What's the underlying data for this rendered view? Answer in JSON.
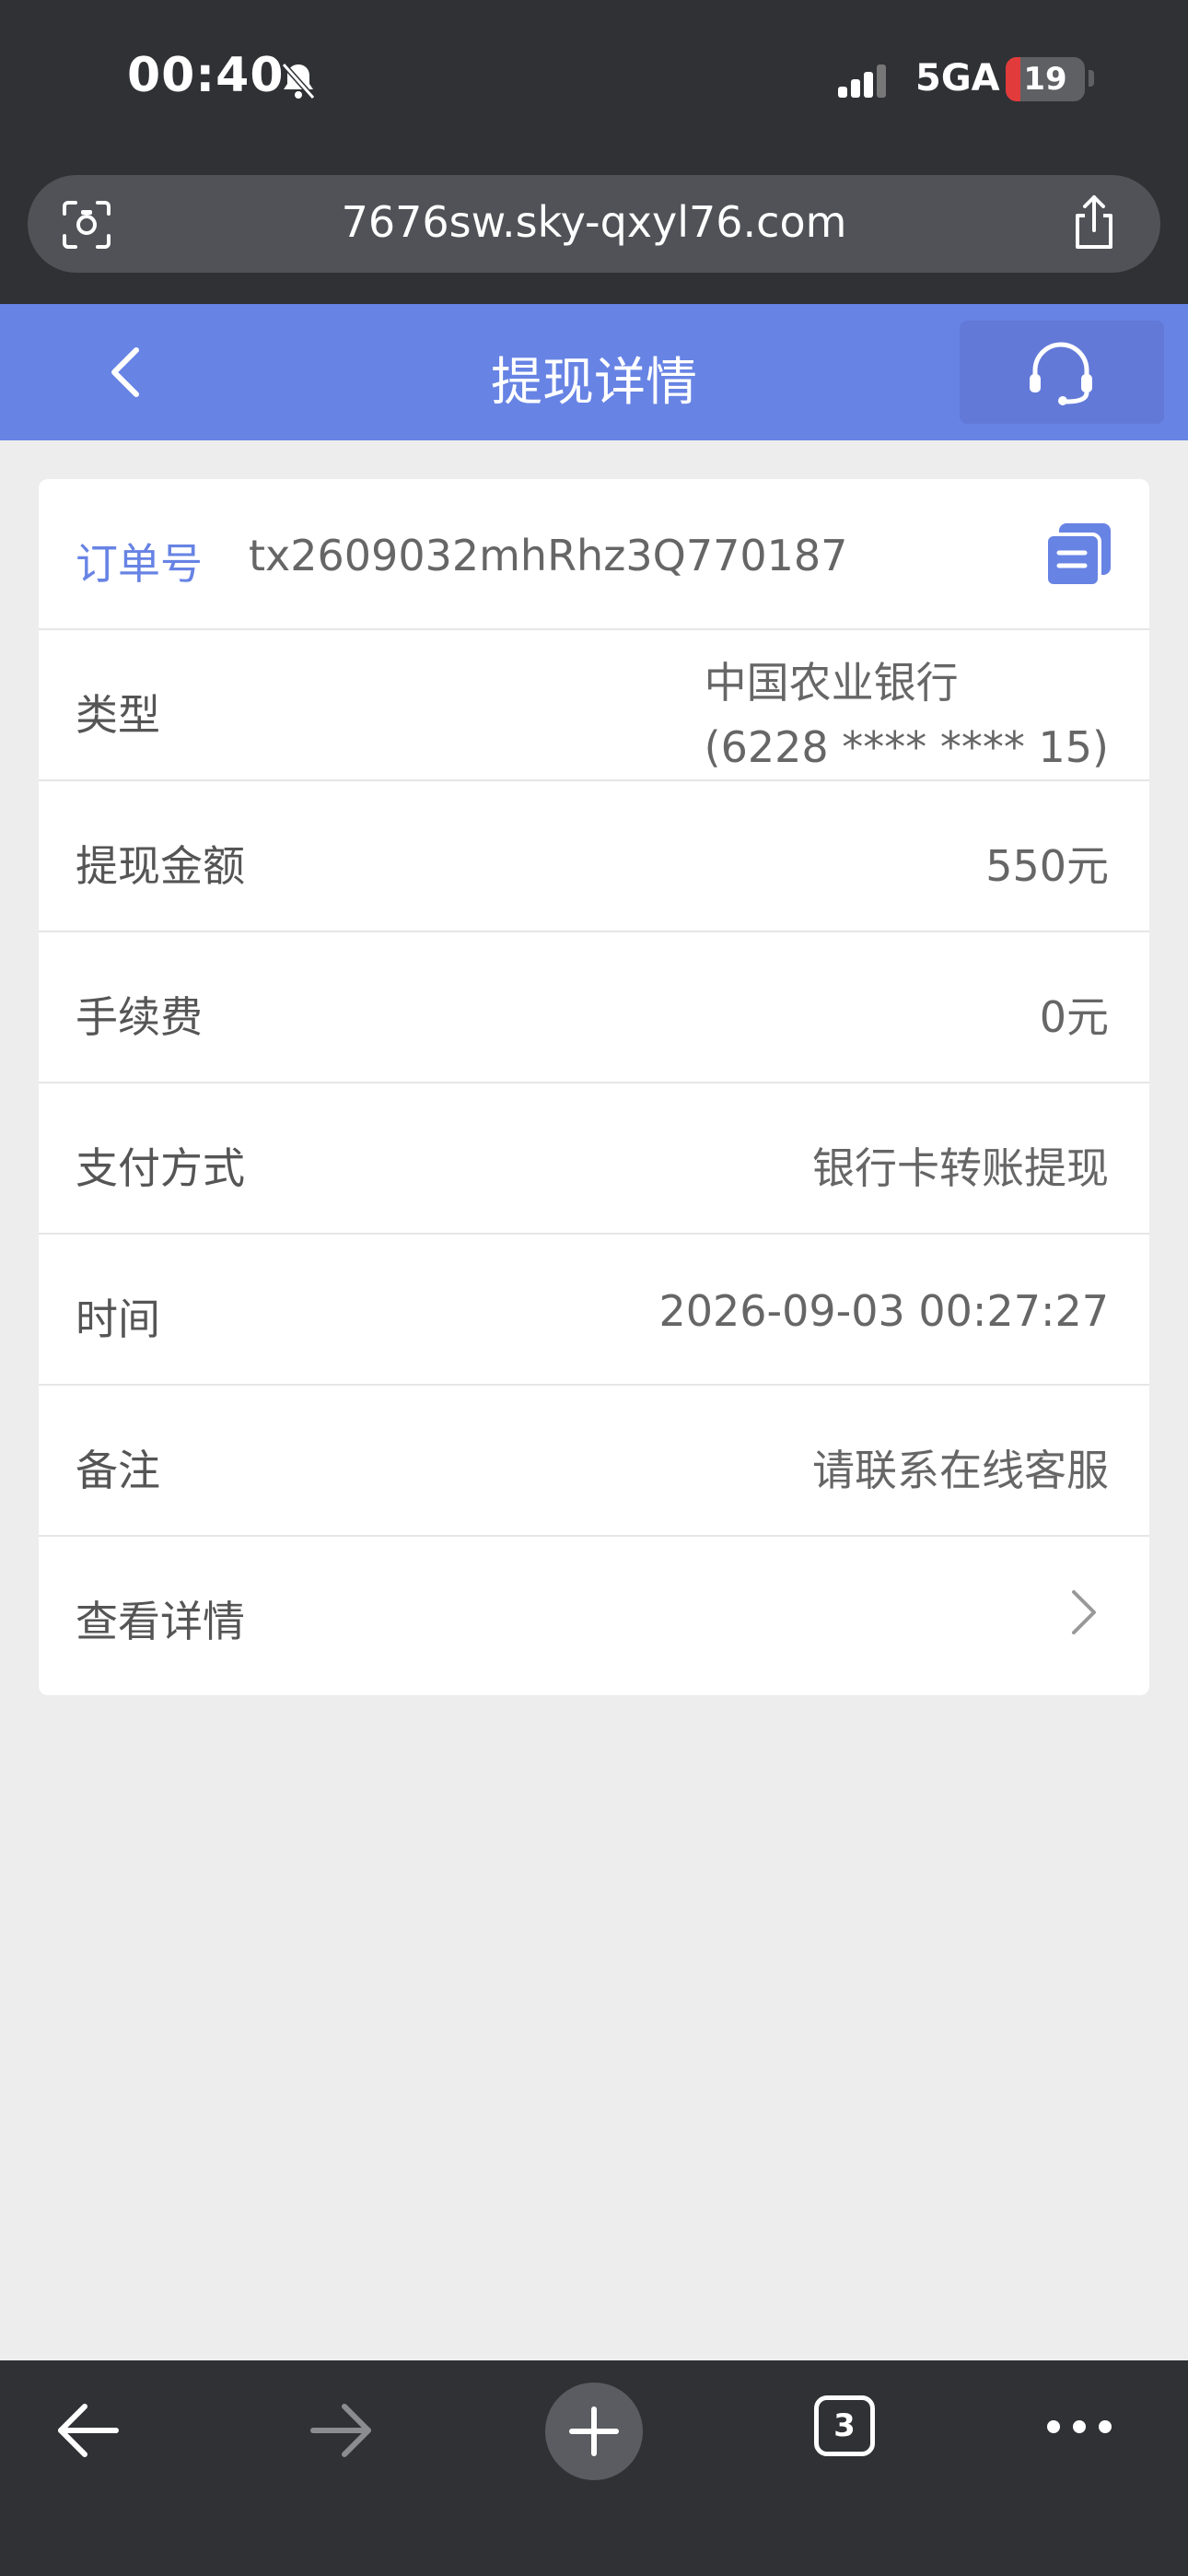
{
  "status_bar": {
    "time": "00:40",
    "network": "5GA",
    "battery": "19",
    "battery_level": 0.19
  },
  "browser": {
    "url": "7676sw.sky-qxyl76.com",
    "open_tabs": "3"
  },
  "header": {
    "title": "提现详情"
  },
  "order": {
    "label": "订单号",
    "value": "tx2609032mhRhz3Q770187"
  },
  "rows": [
    {
      "label": "类型",
      "value_line1": "中国农业银行",
      "value_line2": "(6228 **** **** 15)"
    },
    {
      "label": "提现金额",
      "value": "550元"
    },
    {
      "label": "手续费",
      "value": "0元"
    },
    {
      "label": "支付方式",
      "value": "银行卡转账提现"
    },
    {
      "label": "时间",
      "value": "2026-09-03 00:27:27"
    },
    {
      "label": "备注",
      "value": "请联系在线客服"
    },
    {
      "label": "查看详情"
    }
  ],
  "colors": {
    "accent": "#6783e4",
    "chrome": "#2f3135",
    "background": "#ededed"
  }
}
